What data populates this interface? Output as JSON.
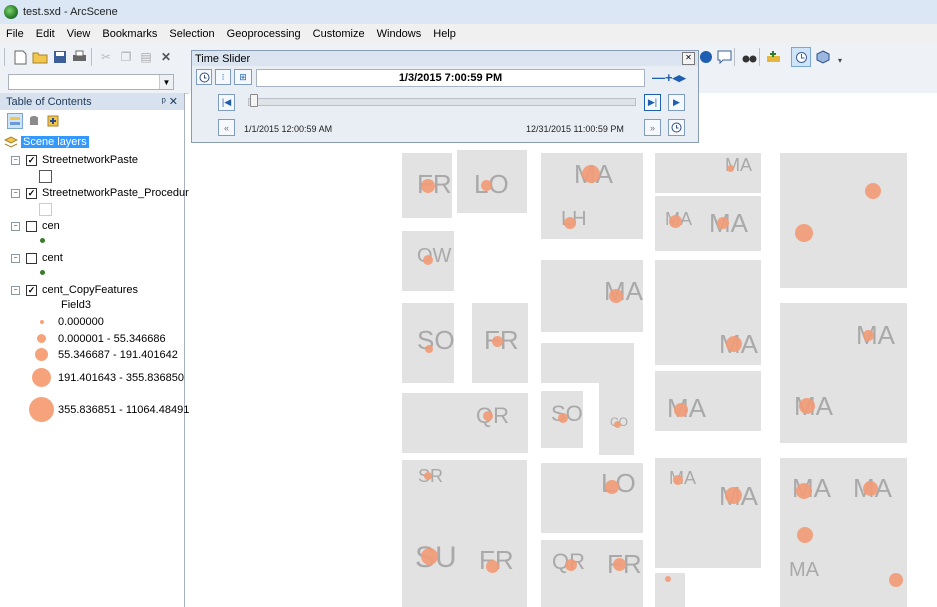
{
  "window": {
    "title": "test.sxd - ArcScene"
  },
  "menu": [
    "File",
    "Edit",
    "View",
    "Bookmarks",
    "Selection",
    "Geoprocessing",
    "Customize",
    "Windows",
    "Help"
  ],
  "toc": {
    "title": "Table of Contents",
    "pin": "&#x2645;",
    "scene_layers": "Scene layers",
    "layers": [
      {
        "name": "StreetnetworkPaste",
        "checked": true
      },
      {
        "name": "StreetnetworkPaste_Procedur",
        "checked": true
      },
      {
        "name": "cen",
        "checked": false
      },
      {
        "name": "cent",
        "checked": false
      },
      {
        "name": "cent_CopyFeatures",
        "checked": true
      }
    ],
    "field": "Field3",
    "classes": [
      "0.000000",
      "0.000001 - 55.346686",
      "55.346687 - 191.401642",
      "191.401643 - 355.836850",
      "355.836851 - 11064.484914"
    ]
  },
  "time_slider": {
    "title": "Time Slider",
    "current_time": "1/3/2015 7:00:59 PM",
    "start_time": "1/1/2015 12:00:59 AM",
    "end_time": "12/31/2015 11:00:59 PM",
    "position_fraction": 0.006
  },
  "map_labels": [
    "FR",
    "LO",
    "MA",
    "LH",
    "MA",
    "MA",
    "MA",
    "OW",
    "MA",
    "SO",
    "FR",
    "MA",
    "MA",
    "QR",
    "SO",
    "CO",
    "MA",
    "MA",
    "SR",
    "LO",
    "MA",
    "MA",
    "MA",
    "MA",
    "SU",
    "FR",
    "QR",
    "FR",
    "MA"
  ],
  "colors": {
    "symbol": "#f29a74",
    "block": "#e2e2e2",
    "label": "#a9a9a9",
    "selection": "#3399ff"
  }
}
